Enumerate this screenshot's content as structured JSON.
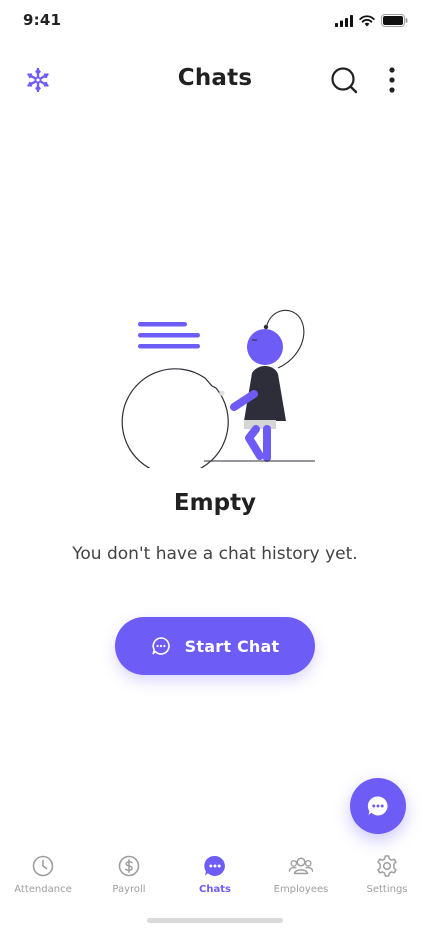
{
  "status_bar": {
    "time": "9:41"
  },
  "header": {
    "title": "Chats"
  },
  "empty_state": {
    "title": "Empty",
    "description": "You don't have a chat history yet."
  },
  "start_chat": {
    "label": "Start Chat"
  },
  "bottom_nav": {
    "items": [
      {
        "label": "Attendance",
        "icon": "clock-icon",
        "active": false
      },
      {
        "label": "Payroll",
        "icon": "dollar-icon",
        "active": false
      },
      {
        "label": "Chats",
        "icon": "chat-icon",
        "active": true
      },
      {
        "label": "Employees",
        "icon": "people-icon",
        "active": false
      },
      {
        "label": "Settings",
        "icon": "gear-icon",
        "active": false
      }
    ]
  },
  "colors": {
    "accent": "#6E5CF7",
    "text": "#212121",
    "muted": "#9E9E9E"
  }
}
